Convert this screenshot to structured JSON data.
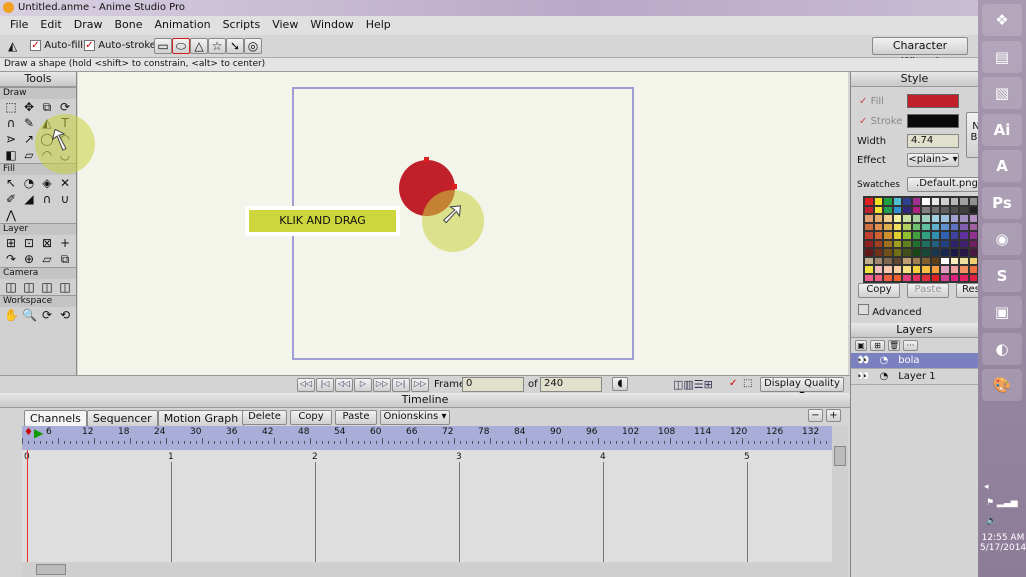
{
  "window": {
    "title": "Untitled.anme - Anime Studio Pro"
  },
  "menu": [
    "File",
    "Edit",
    "Draw",
    "Bone",
    "Animation",
    "Scripts",
    "View",
    "Window",
    "Help"
  ],
  "toolbar": {
    "autofill": "Auto-fill",
    "autostroke": "Auto-stroke",
    "character_wizard": "Character Wizard",
    "shapes": [
      "rectangle",
      "oval",
      "triangle",
      "star",
      "arrow",
      "spiral"
    ],
    "selected_shape": "oval"
  },
  "status": "Draw a shape (hold <shift> to constrain, <alt> to center)",
  "tools": {
    "title": "Tools",
    "sections": [
      {
        "label": "Draw",
        "icons": [
          "⬚",
          "✥",
          "⧉",
          "⟳",
          "∩",
          "✎",
          "◭",
          "T",
          "⋗",
          "↗",
          "◯",
          "◠",
          "◧",
          "▱",
          "◠",
          "◡"
        ]
      },
      {
        "label": "Fill",
        "icons": [
          "↖",
          "◔",
          "◈",
          "✕",
          "✐",
          "◢",
          "∩",
          "∪",
          "⋀"
        ]
      },
      {
        "label": "Layer",
        "icons": [
          "⊞",
          "⊡",
          "⊠",
          "+",
          "↷",
          "⊕",
          "▱",
          "⧉"
        ]
      },
      {
        "label": "Camera",
        "icons": [
          "◫",
          "◫",
          "◫",
          "◫"
        ]
      },
      {
        "label": "Workspace",
        "icons": [
          "✋",
          "🔍",
          "⟳",
          "⟲"
        ]
      }
    ]
  },
  "canvas": {
    "callout": "KLIK AND DRAG",
    "shape_color": "#c0202a",
    "frame_color": "#a09cd4"
  },
  "style": {
    "title": "Style",
    "fill_label": "Fill",
    "fill_color": "#c0202a",
    "stroke_label": "Stroke",
    "stroke_color": "#0a0a0a",
    "width_label": "Width",
    "width_value": "4.74",
    "effect_label": "Effect",
    "effect_value": "<plain>",
    "swatches_label": "Swatches",
    "swatches_value": ".Default.png",
    "copy": "Copy",
    "paste": "Paste",
    "reset": "Res",
    "advanced": "Advanced",
    "side_btn": "N Br"
  },
  "palette": [
    [
      "#e02020",
      "#f0e020",
      "#20a040",
      "#50c0d0",
      "#304090",
      "#a03090",
      "#ffffff",
      "#e8e8e8",
      "#d0d0d0",
      "#b8b8b8",
      "#a0a0a0",
      "#909090"
    ],
    [
      "#c02030",
      "#f0e030",
      "#20a050",
      "#3090d0",
      "#302878",
      "#b02080",
      "#808080",
      "#707070",
      "#606060",
      "#505050",
      "#404040",
      "#202020"
    ],
    [
      "#e0a070",
      "#e8b070",
      "#f0d090",
      "#f0f0a0",
      "#c8e0a0",
      "#a8d0a0",
      "#a0d0c0",
      "#a0d0e0",
      "#a0c0e0",
      "#a0a0d0",
      "#a090c0",
      "#b090c0"
    ],
    [
      "#d07040",
      "#e09050",
      "#e0b050",
      "#f0e060",
      "#b0d060",
      "#70c070",
      "#60c0a0",
      "#60b0d0",
      "#6090d0",
      "#6070c0",
      "#8060b0",
      "#a060a0"
    ],
    [
      "#c04030",
      "#d06030",
      "#d09030",
      "#e0d030",
      "#90c030",
      "#40a040",
      "#30a080",
      "#3090b0",
      "#3060b0",
      "#4040a0",
      "#6030a0",
      "#903090"
    ],
    [
      "#902020",
      "#a04020",
      "#a07020",
      "#a0a020",
      "#608020",
      "#207030",
      "#207060",
      "#206080",
      "#204080",
      "#302070",
      "#402070",
      "#702060"
    ],
    [
      "#601818",
      "#703018",
      "#705018",
      "#707018",
      "#405018",
      "#184818",
      "#184838",
      "#183850",
      "#182850",
      "#181848",
      "#281848",
      "#481840"
    ],
    [
      "#c0b090",
      "#a08870",
      "#806850",
      "#604830",
      "#c0a070",
      "#a08050",
      "#806030",
      "#604018",
      "#ffffff",
      "#fff0c0",
      "#f0e0a0",
      "#f0d070"
    ],
    [
      "#f0e040",
      "#f0c0c0",
      "#f8c8b0",
      "#f8d0a0",
      "#f8e080",
      "#f8d040",
      "#f8c040",
      "#f8a040",
      "#e0a0c0",
      "#f0a0a0",
      "#f09060",
      "#f07040"
    ],
    [
      "#f06090",
      "#f06080",
      "#f06040",
      "#f06030",
      "#e04080",
      "#e03060",
      "#e03040",
      "#e02020",
      "#d04090",
      "#e02080",
      "#e02060",
      "#e02040"
    ]
  ],
  "layers": {
    "title": "Layers",
    "items": [
      {
        "name": "bola",
        "selected": true
      },
      {
        "name": "Layer 1",
        "selected": false
      }
    ]
  },
  "playback": {
    "frame_label": "Frame",
    "frame_value": "0",
    "of_label": "of",
    "total": "240",
    "display_quality": "Display Quality"
  },
  "timeline": {
    "title": "Timeline",
    "tabs": [
      "Channels",
      "Sequencer",
      "Motion Graph"
    ],
    "active_tab": "Channels",
    "delete": "Delete",
    "copy": "Copy",
    "paste": "Paste",
    "onionskins": "Onionskins",
    "ruler": [
      "6",
      "12",
      "18",
      "24",
      "30",
      "36",
      "42",
      "48",
      "54",
      "60",
      "66",
      "72",
      "78",
      "84",
      "90",
      "96",
      "102",
      "108",
      "114",
      "120",
      "126",
      "132"
    ],
    "seconds": [
      "0",
      "1",
      "2",
      "3",
      "4",
      "5"
    ]
  },
  "taskbar": {
    "time": "12:55 AM",
    "date": "5/17/2014",
    "apps": [
      "start",
      "explorer",
      "sticky-notes",
      "illustrator",
      "anime-studio",
      "photoshop",
      "chrome",
      "skype",
      "photo-viewer",
      "firefox",
      "paint"
    ]
  }
}
